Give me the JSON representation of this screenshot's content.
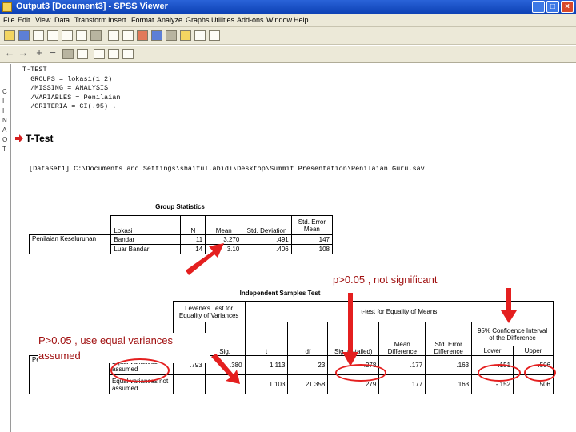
{
  "window": {
    "title": "Output3 [Document3] - SPSS Viewer",
    "buttons": {
      "minimize": "_",
      "maximize": "□",
      "close": "×"
    }
  },
  "menu": [
    "File",
    "Edit",
    "View",
    "Data",
    "Transform",
    "Insert",
    "Format",
    "Analyze",
    "Graphs",
    "Utilities",
    "Add-ons",
    "Window",
    "Help"
  ],
  "toolbar2_symbols": [
    "←",
    "→",
    "+",
    "−"
  ],
  "left_pane_letters": [
    "C",
    "I",
    "I",
    "N",
    "A",
    "O",
    "T"
  ],
  "syntax": "T-TEST\n  GROUPS = lokasi(1 2)\n  /MISSING = ANALYSIS\n  /VARIABLES = Penilaian\n  /CRITERIA = CI(.95) .",
  "section_heading": "T-Test",
  "dataset_line": "[DataSet1] C:\\Documents and Settings\\shaiful.abidi\\Desktop\\Summit Presentation\\Penilaian Guru.sav",
  "group_statistics": {
    "caption": "Group Statistics",
    "headers": [
      "",
      "Lokasi",
      "N",
      "Mean",
      "Std. Deviation",
      "Std. Error Mean"
    ],
    "row_label": "Penilaian Keseluruhan",
    "rows": [
      {
        "lokasi": "Bandar",
        "n": "11",
        "mean": "3.270",
        "sd": ".491",
        "se": ".147"
      },
      {
        "lokasi": "Luar Bandar",
        "n": "14",
        "mean": "3.10",
        "sd": ".406",
        "se": ".108"
      }
    ]
  },
  "independent_samples_test": {
    "caption": "Independent Samples Test",
    "levene_header": "Levene's Test for Equality of Variances",
    "ttest_header": "t-test for Equality of Means",
    "ci_header": "95% Confidence Interval of the Difference",
    "columns": [
      "F",
      "Sig.",
      "t",
      "df",
      "Sig. (2-tailed)",
      "Mean Difference",
      "Std. Error Difference",
      "Lower",
      "Upper"
    ],
    "row_label": "Penilaian Keseluruhan",
    "rows": [
      {
        "label": "Equal variances assumed",
        "F": ".793",
        "Sig": ".380",
        "t": "1.113",
        "df": "23",
        "sig2": ".278",
        "md": ".177",
        "sed": ".163",
        "lower": "-.151",
        "upper": ".506"
      },
      {
        "label": "Equal variances not assumed",
        "F": "",
        "Sig": "",
        "t": "1.103",
        "df": "21.358",
        "sig2": ".279",
        "md": ".177",
        "sed": ".163",
        "lower": "-.152",
        "upper": ".506"
      }
    ]
  },
  "annotations": {
    "not_significant": "p>0.05 , not significant",
    "equal_variances": "P>0.05 , use equal variances assumed"
  },
  "colors": {
    "annotation_red": "#e41f1f",
    "title_blue": "#0b3fb3",
    "chrome": "#ece9d8"
  }
}
